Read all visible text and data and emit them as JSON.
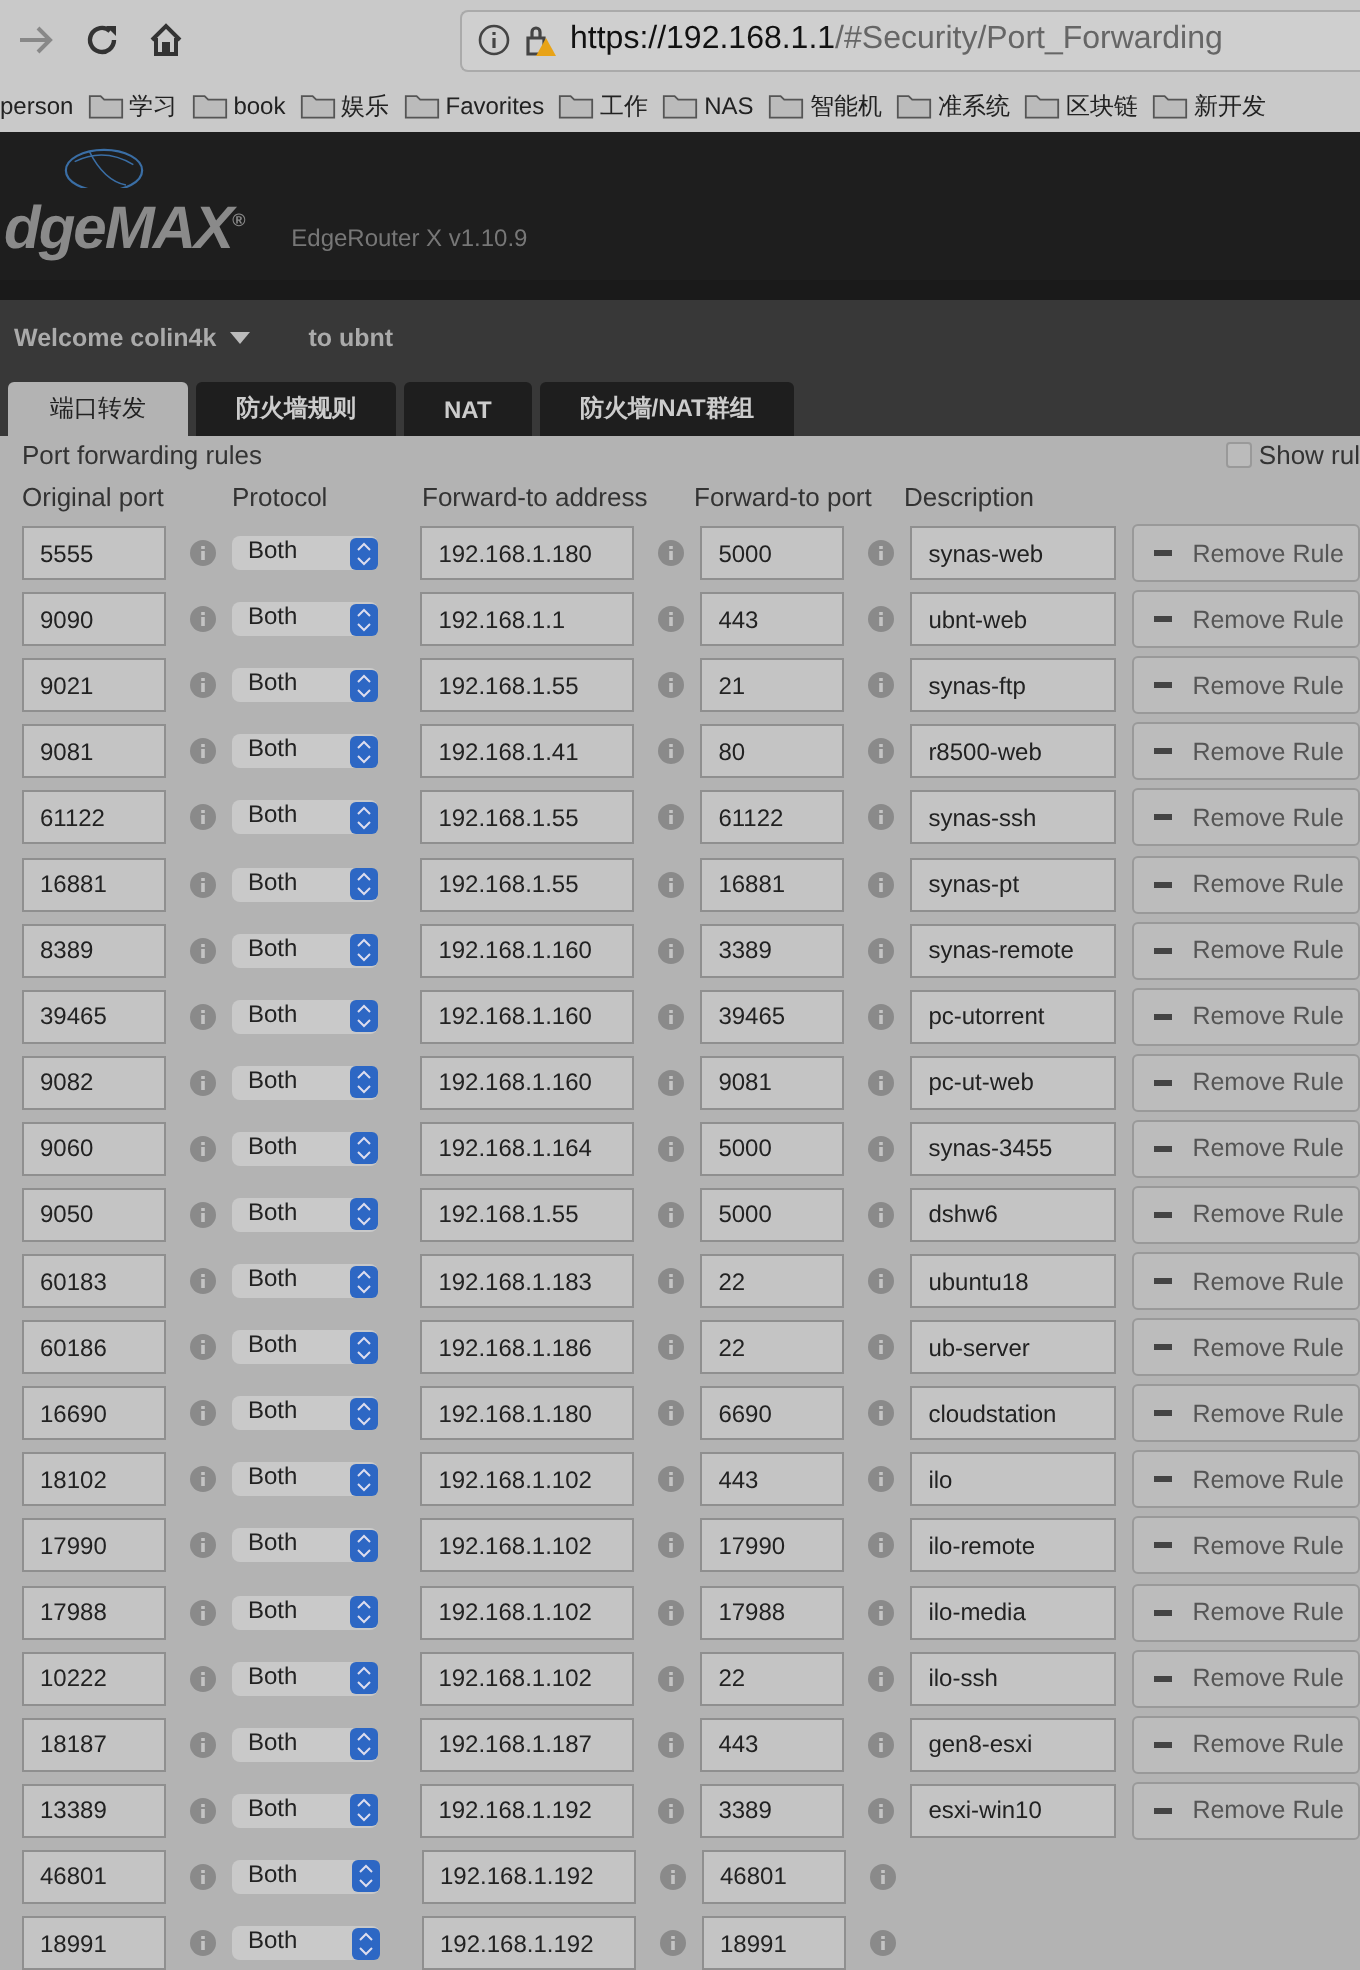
{
  "browser": {
    "url_host": "https://192.168.1.1",
    "url_path": "/#Security/Port_Forwarding",
    "bookmarks": [
      {
        "label": "person",
        "folder": false
      },
      {
        "label": "学习",
        "folder": true
      },
      {
        "label": "book",
        "folder": true
      },
      {
        "label": "娱乐",
        "folder": true
      },
      {
        "label": "Favorites",
        "folder": true
      },
      {
        "label": "工作",
        "folder": true
      },
      {
        "label": "NAS",
        "folder": true
      },
      {
        "label": "智能机",
        "folder": true
      },
      {
        "label": "准系统",
        "folder": true
      },
      {
        "label": "区块链",
        "folder": true
      },
      {
        "label": "新开发",
        "folder": true
      }
    ]
  },
  "header": {
    "logo": "dgeMAX$^{®}$",
    "product": "EdgeRouter X v1.10.9"
  },
  "nav": {
    "welcome": "Welcome colin4k",
    "target": "to ubnt"
  },
  "tabs": [
    {
      "label": "端口转发",
      "selected": true
    },
    {
      "label": "防火墙规则",
      "selected": false
    },
    {
      "label": "NAT",
      "selected": false
    },
    {
      "label": "防火墙/NAT群组",
      "selected": false
    }
  ],
  "section_title": "Port forwarding rules",
  "show_rules": {
    "label": "Show rul",
    "checked": false
  },
  "columns": [
    "Original port",
    "Protocol",
    "Forward-to address",
    "Forward-to port",
    "Description"
  ],
  "rows": [
    {
      "port": "5555",
      "protocol": "Both",
      "address": "192.168.1.180",
      "to_port": "5000",
      "description": "synas-web",
      "action": "Remove Rule"
    },
    {
      "port": "9090",
      "protocol": "Both",
      "address": "192.168.1.1",
      "to_port": "443",
      "description": "ubnt-web",
      "action": "Remove Rule"
    },
    {
      "port": "9021",
      "protocol": "Both",
      "address": "192.168.1.55",
      "to_port": "21",
      "description": "synas-ftp",
      "action": "Remove Rule"
    },
    {
      "port": "9081",
      "protocol": "Both",
      "address": "192.168.1.41",
      "to_port": "80",
      "description": "r8500-web",
      "action": "Remove Rule"
    },
    {
      "port": "61122",
      "protocol": "Both",
      "address": "192.168.1.55",
      "to_port": "61122",
      "description": "synas-ssh",
      "action": "Remove Rule"
    },
    {
      "port": "16881",
      "protocol": "Both",
      "address": "192.168.1.55",
      "to_port": "16881",
      "description": "synas-pt",
      "action": "Remove Rule"
    },
    {
      "port": "8389",
      "protocol": "Both",
      "address": "192.168.1.160",
      "to_port": "3389",
      "description": "synas-remote",
      "action": "Remove Rule"
    },
    {
      "port": "39465",
      "protocol": "Both",
      "address": "192.168.1.160",
      "to_port": "39465",
      "description": "pc-utorrent",
      "action": "Remove Rule"
    },
    {
      "port": "9082",
      "protocol": "Both",
      "address": "192.168.1.160",
      "to_port": "9081",
      "description": "pc-ut-web",
      "action": "Remove Rule"
    },
    {
      "port": "9060",
      "protocol": "Both",
      "address": "192.168.1.164",
      "to_port": "5000",
      "description": "synas-3455",
      "action": "Remove Rule"
    },
    {
      "port": "9050",
      "protocol": "Both",
      "address": "192.168.1.55",
      "to_port": "5000",
      "description": "dshw6",
      "action": "Remove Rule"
    },
    {
      "port": "60183",
      "protocol": "Both",
      "address": "192.168.1.183",
      "to_port": "22",
      "description": "ubuntu18",
      "action": "Remove Rule"
    },
    {
      "port": "60186",
      "protocol": "Both",
      "address": "192.168.1.186",
      "to_port": "22",
      "description": "ub-server",
      "action": "Remove Rule"
    },
    {
      "port": "16690",
      "protocol": "Both",
      "address": "192.168.1.180",
      "to_port": "6690",
      "description": "cloudstation",
      "action": "Remove Rule"
    },
    {
      "port": "18102",
      "protocol": "Both",
      "address": "192.168.1.102",
      "to_port": "443",
      "description": "ilo",
      "action": "Remove Rule"
    },
    {
      "port": "17990",
      "protocol": "Both",
      "address": "192.168.1.102",
      "to_port": "17990",
      "description": "ilo-remote",
      "action": "Remove Rule"
    },
    {
      "port": "17988",
      "protocol": "Both",
      "address": "192.168.1.102",
      "to_port": "17988",
      "description": "ilo-media",
      "action": "Remove Rule"
    },
    {
      "port": "10222",
      "protocol": "Both",
      "address": "192.168.1.102",
      "to_port": "22",
      "description": "ilo-ssh",
      "action": "Remove Rule"
    },
    {
      "port": "18187",
      "protocol": "Both",
      "address": "192.168.1.187",
      "to_port": "443",
      "description": "gen8-esxi",
      "action": "Remove Rule"
    },
    {
      "port": "13389",
      "protocol": "Both",
      "address": "192.168.1.192",
      "to_port": "3389",
      "description": "esxi-win10",
      "action": "Remove Rule"
    },
    {
      "port": "46801",
      "protocol": "Both",
      "address": "192.168.1.192",
      "to_port": "46801"
    },
    {
      "port": "18991",
      "protocol": "Both",
      "address": "192.168.1.192",
      "to_port": "18991"
    }
  ]
}
